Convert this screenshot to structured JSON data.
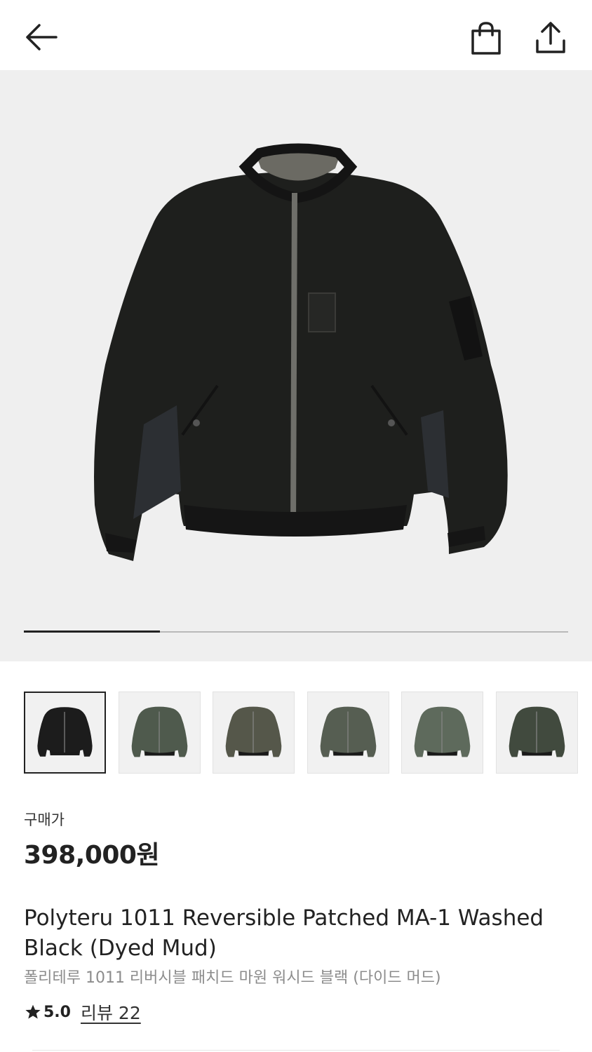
{
  "header": {
    "back_icon": "arrow-left-icon",
    "bag_icon": "shopping-bag-icon",
    "share_icon": "share-upload-icon"
  },
  "gallery": {
    "total_images": 4,
    "current_image": 1,
    "progress_fraction": 0.25,
    "thumbnails": [
      {
        "color": "#1c1c1c",
        "selected": true
      },
      {
        "color": "#4f5a4d",
        "selected": false
      },
      {
        "color": "#55574a",
        "selected": false
      },
      {
        "color": "#565e52",
        "selected": false
      },
      {
        "color": "#5e6a5c",
        "selected": false
      },
      {
        "color": "#414a3e",
        "selected": false
      }
    ]
  },
  "product": {
    "price_label": "구매가",
    "price": "398,000원",
    "name_en": "Polyteru 1011 Reversible Patched MA-1 Washed Black (Dyed Mud)",
    "name_ko": "폴리테루 1011 리버시블 패치드 마원 워시드 블랙 (다이드 머드)",
    "rating": "5.0",
    "review_link": "리뷰 22"
  },
  "colors": {
    "text": "#222222",
    "muted": "#8c8c8c",
    "hero_bg": "#efefef",
    "thumb_bg": "#f1f1f1"
  }
}
